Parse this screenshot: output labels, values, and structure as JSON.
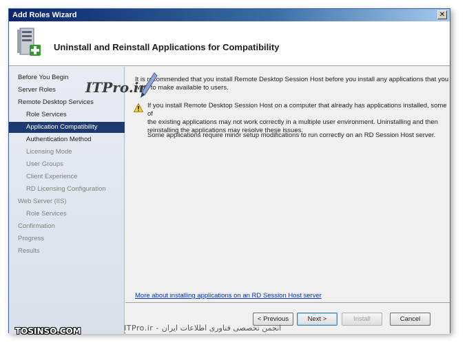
{
  "window": {
    "title": "Add Roles Wizard",
    "close_glyph": "✕"
  },
  "header": {
    "title": "Uninstall and Reinstall Applications for Compatibility",
    "icon": "server-add-icon"
  },
  "sidebar": {
    "items": [
      {
        "label": "Before You Begin",
        "level": "top",
        "state": "normal"
      },
      {
        "label": "Server Roles",
        "level": "top",
        "state": "normal"
      },
      {
        "label": "Remote Desktop Services",
        "level": "top",
        "state": "normal"
      },
      {
        "label": "Role Services",
        "level": "sub",
        "state": "normal"
      },
      {
        "label": "Application Compatibility",
        "level": "sub",
        "state": "selected"
      },
      {
        "label": "Authentication Method",
        "level": "sub",
        "state": "normal"
      },
      {
        "label": "Licensing Mode",
        "level": "sub",
        "state": "disabled"
      },
      {
        "label": "User Groups",
        "level": "sub",
        "state": "disabled"
      },
      {
        "label": "Client Experience",
        "level": "sub",
        "state": "disabled"
      },
      {
        "label": "RD Licensing Configuration",
        "level": "sub",
        "state": "disabled"
      },
      {
        "label": "Web Server (IIS)",
        "level": "top",
        "state": "disabled"
      },
      {
        "label": "Role Services",
        "level": "sub",
        "state": "disabled"
      },
      {
        "label": "Confirmation",
        "level": "top",
        "state": "disabled"
      },
      {
        "label": "Progress",
        "level": "top",
        "state": "disabled"
      },
      {
        "label": "Results",
        "level": "top",
        "state": "disabled"
      }
    ]
  },
  "content": {
    "intro_line1": "It is recommended that you install Remote Desktop Session Host before you install any applications that you",
    "intro_line2": "want to make available to users.",
    "warning_line1": "If you install Remote Desktop Session Host on a computer that already has applications installed, some of",
    "warning_line2": "the existing applications may not work correctly in a multiple user environment. Uninstalling and then",
    "warning_line3": "reinstalling the applications may resolve these issues.",
    "note": "Some applications require minor setup modifications to run correctly on an RD Session Host server.",
    "link": "More about installing applications on an RD Session Host server"
  },
  "footer": {
    "previous": "< Previous",
    "next": "Next >",
    "install": "Install",
    "cancel": "Cancel"
  },
  "watermarks": {
    "itpro": "ITPro.ir",
    "bottom": "ITPro.ir - انجمن تخصصی فناوری اطلاعات ایران",
    "tosinso": "TOSINSO.COM"
  },
  "colors": {
    "selected_bg": "#1c3a70",
    "link": "#0033cc",
    "titlebar": "#0a246a"
  }
}
